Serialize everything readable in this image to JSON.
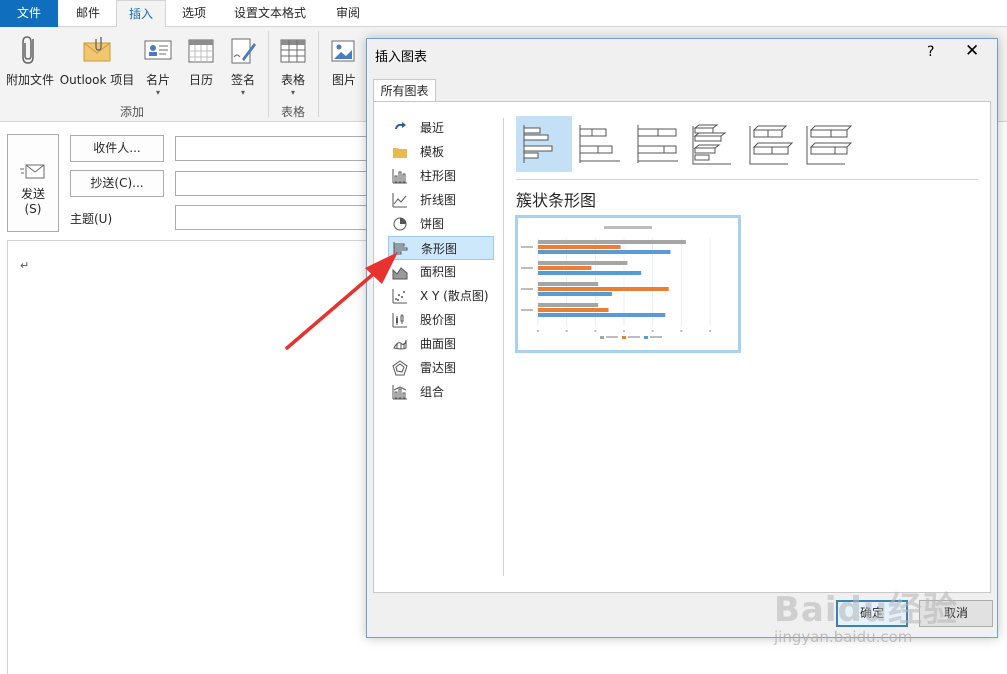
{
  "ribbon": {
    "tabs": [
      "文件",
      "邮件",
      "插入",
      "选项",
      "设置文本格式",
      "审阅"
    ],
    "active_tab": "插入",
    "buttons": {
      "attach_file": "附加文件",
      "outlook_item": "Outlook 项目",
      "business_card": "名片",
      "calendar": "日历",
      "signature": "签名",
      "table": "表格",
      "picture": "图片"
    },
    "groups": {
      "add": "添加",
      "tables": "表格"
    }
  },
  "compose": {
    "send_label": "发送",
    "send_key": "(S)",
    "to_button": "收件人...",
    "cc_button": "抄送(C)...",
    "subject_label": "主题(U)",
    "body_caret": "↵"
  },
  "dialog": {
    "title": "插入图表",
    "help": "?",
    "close": "✕",
    "tab": "所有图表",
    "categories": [
      {
        "label": "最近",
        "icon": "recent-icon"
      },
      {
        "label": "模板",
        "icon": "folder-icon"
      },
      {
        "label": "柱形图",
        "icon": "column-chart-icon"
      },
      {
        "label": "折线图",
        "icon": "line-chart-icon"
      },
      {
        "label": "饼图",
        "icon": "pie-chart-icon"
      },
      {
        "label": "条形图",
        "icon": "bar-chart-icon"
      },
      {
        "label": "面积图",
        "icon": "area-chart-icon"
      },
      {
        "label": "X Y (散点图)",
        "icon": "scatter-chart-icon"
      },
      {
        "label": "股价图",
        "icon": "stock-chart-icon"
      },
      {
        "label": "曲面图",
        "icon": "surface-chart-icon"
      },
      {
        "label": "雷达图",
        "icon": "radar-chart-icon"
      },
      {
        "label": "组合",
        "icon": "combo-chart-icon"
      }
    ],
    "selected_category": "条形图",
    "subtype_name": "簇状条形图",
    "ok": "确定",
    "cancel": "取消"
  },
  "watermark": {
    "brand": "Baidu经验",
    "url": "jingyan.baidu.com"
  },
  "colors": {
    "accent": "#106ebe",
    "selection": "#cde8fb",
    "arrow": "#e8322f",
    "series_gray": "#a5a5a5",
    "series_orange": "#ed7d31",
    "series_blue": "#5b9bd5"
  }
}
